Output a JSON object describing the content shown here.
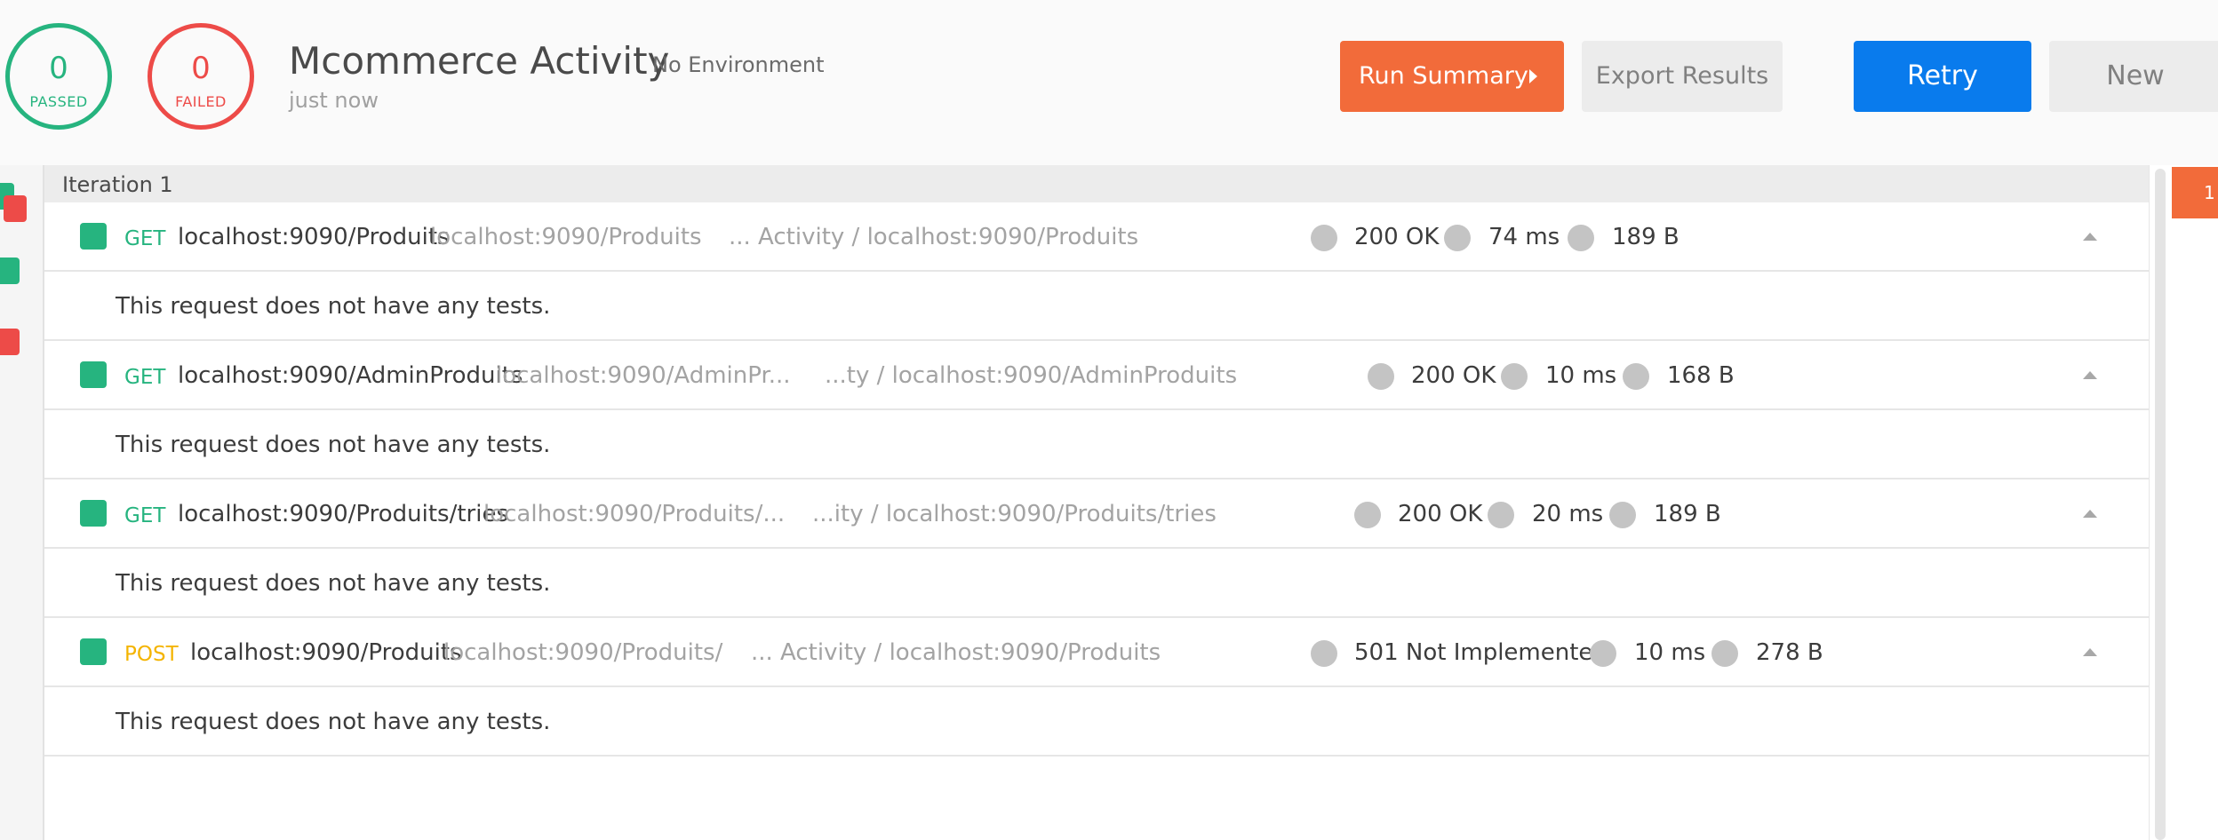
{
  "summary": {
    "passed": {
      "count": "0",
      "label": "PASSED"
    },
    "failed": {
      "count": "0",
      "label": "FAILED"
    },
    "title": "Mcommerce Activity",
    "environment": "No Environment",
    "time": "just now"
  },
  "buttons": {
    "run_summary": "Run Summary",
    "export": "Export Results",
    "retry": "Retry",
    "new": "New"
  },
  "iteration": {
    "label": "Iteration 1"
  },
  "requests": [
    {
      "method": "GET",
      "name": "localhost:9090/Produits",
      "url": "localhost:9090/Produits",
      "path": "... Activity / localhost:9090/Produits",
      "status": "200 OK",
      "time": "74 ms",
      "size": "189 B",
      "tests_message": "This request does not have any tests."
    },
    {
      "method": "GET",
      "name": "localhost:9090/AdminProduits",
      "url": "localhost:9090/AdminPr...",
      "path": "...ty / localhost:9090/AdminProduits",
      "status": "200 OK",
      "time": "10 ms",
      "size": "168 B",
      "tests_message": "This request does not have any tests."
    },
    {
      "method": "GET",
      "name": "localhost:9090/Produits/tries",
      "url": "localhost:9090/Produits/...",
      "path": "...ity / localhost:9090/Produits/tries",
      "status": "200 OK",
      "time": "20 ms",
      "size": "189 B",
      "tests_message": "This request does not have any tests."
    },
    {
      "method": "POST",
      "name": "localhost:9090/Produits",
      "url": "localhost:9090/Produits/",
      "path": "... Activity / localhost:9090/Produits",
      "status": "501 Not Implemented",
      "time": "10 ms",
      "size": "278 B",
      "tests_message": "This request does not have any tests."
    }
  ],
  "right_panel": {
    "badge": "1"
  },
  "colors": {
    "passed": "#26b47f",
    "failed": "#ed4b48",
    "run_summary": "#f26b3a",
    "retry": "#097bed",
    "method_get": "#26b47f",
    "method_post": "#f4b400"
  }
}
